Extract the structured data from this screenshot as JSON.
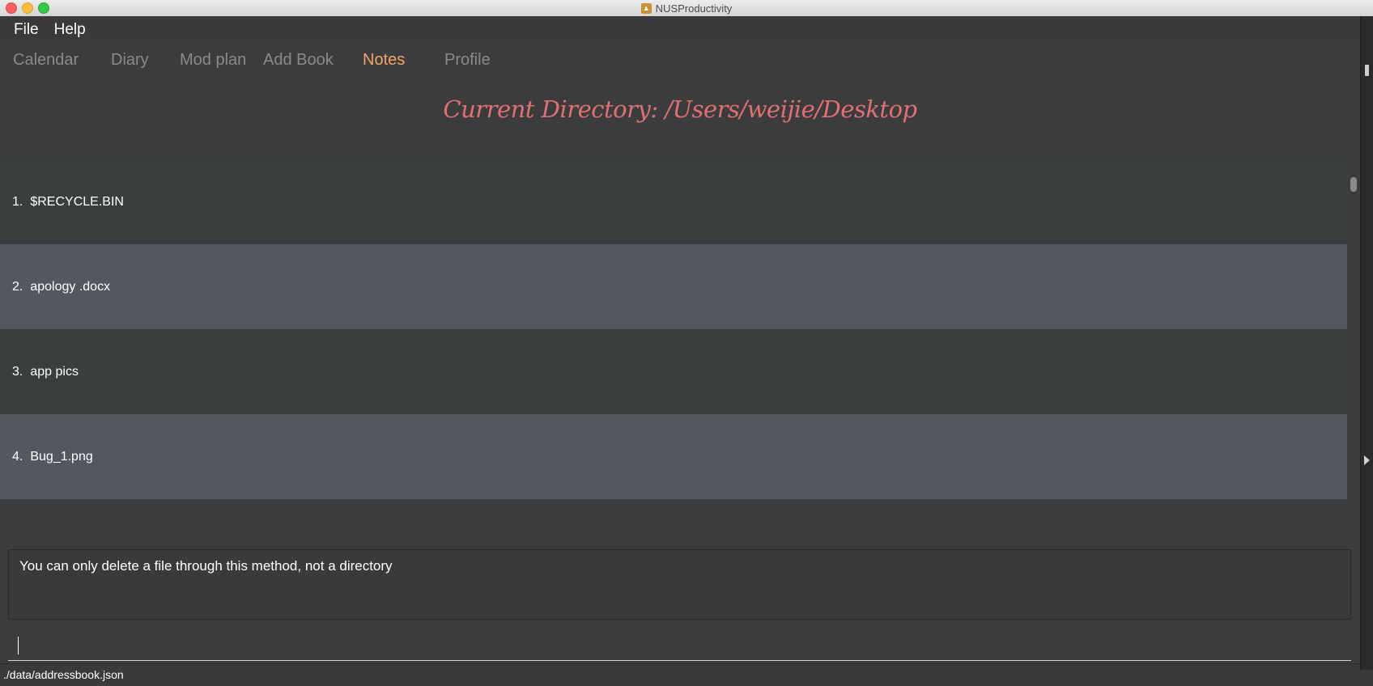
{
  "window": {
    "title": "NUSProductivity"
  },
  "menu": {
    "file": "File",
    "help": "Help"
  },
  "tabs": [
    {
      "label": "Calendar",
      "active": false
    },
    {
      "label": "Diary",
      "active": false
    },
    {
      "label": "Mod plan",
      "active": false
    },
    {
      "label": "Add Book",
      "active": false
    },
    {
      "label": "Notes",
      "active": true
    },
    {
      "label": "Profile",
      "active": false
    }
  ],
  "notes": {
    "heading": "Current Directory: /Users/weijie/Desktop",
    "files": [
      {
        "index": "1.",
        "name": "$RECYCLE.BIN"
      },
      {
        "index": "2.",
        "name": "apology .docx"
      },
      {
        "index": "3.",
        "name": "app pics"
      },
      {
        "index": "4.",
        "name": "Bug_1.png"
      }
    ]
  },
  "result": {
    "message": "You can only delete a file through this method, not a directory"
  },
  "command": {
    "value": ""
  },
  "status": {
    "path": "./data/addressbook.json"
  },
  "colors": {
    "active_tab": "#f5a56a",
    "heading": "#e07075",
    "row_odd": "#3b3e3f",
    "row_even": "#52585b"
  }
}
